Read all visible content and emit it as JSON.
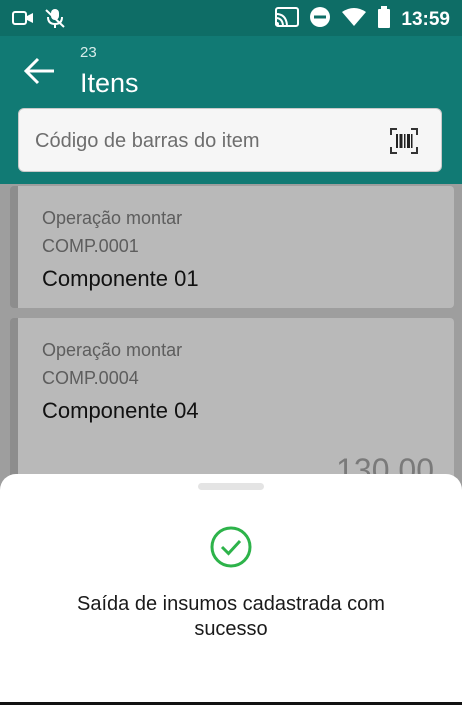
{
  "status_bar": {
    "time": "13:59",
    "icons_left": [
      "screen-record-icon",
      "mic-off-icon"
    ],
    "icons_right": [
      "cast-icon",
      "do-not-disturb-icon",
      "wifi-icon",
      "battery-icon"
    ]
  },
  "app_bar": {
    "subtitle": "23",
    "title": "Itens",
    "back_icon": "arrow-left-icon"
  },
  "search": {
    "placeholder": "Código de barras do item",
    "scan_icon": "barcode-scan-icon"
  },
  "items": [
    {
      "operation": "Operação montar",
      "code": "COMP.0001",
      "name": "Componente 01"
    },
    {
      "operation": "Operação montar",
      "code": "COMP.0004",
      "name": "Componente 04",
      "quantity": "130,00"
    }
  ],
  "sheet": {
    "message": "Saída de insumos cadastrada com sucesso",
    "icon": "check-circle-icon"
  },
  "colors": {
    "primary": "#117a74",
    "status_bar": "#0e6d66",
    "success": "#2db34a"
  }
}
